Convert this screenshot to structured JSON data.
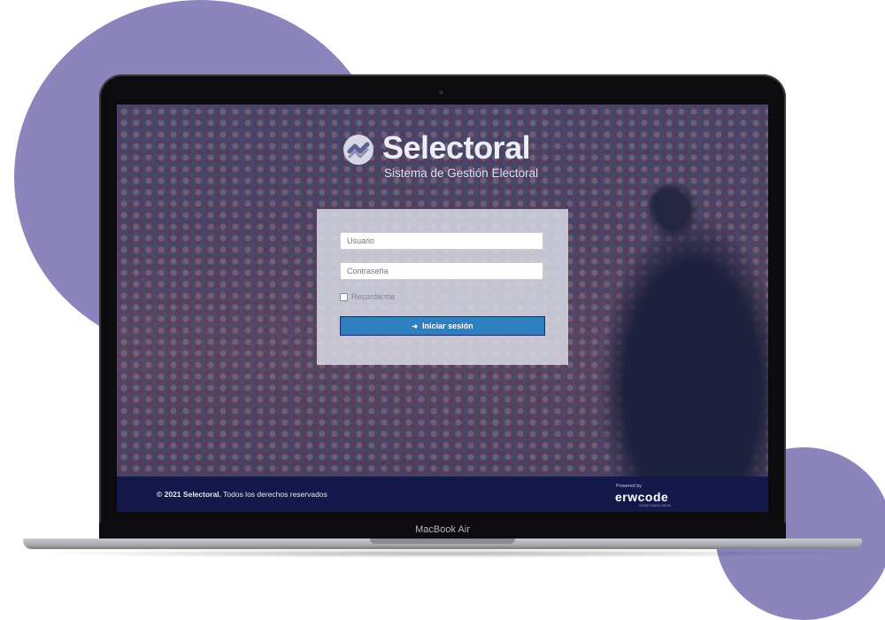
{
  "app": {
    "brand_name": "Selectoral",
    "brand_subtitle": "Sistema de Gestión Electoral"
  },
  "login": {
    "username_placeholder": "Usuario",
    "password_placeholder": "Contraseña",
    "remember_label": "Recordarme",
    "submit_label": "Iniciar sesión",
    "submit_icon": "sign-in-icon"
  },
  "footer": {
    "copyright_year": "© 2021",
    "copyright_brand": "Selectoral.",
    "copyright_text": "Todos los derechos reservados",
    "powered_by": "Powered by",
    "vendor": "erwcode",
    "vendor_sub": "CONECTANDO IDEAS"
  },
  "device": {
    "model": "MacBook Air"
  },
  "colors": {
    "blob": "#8b84bd",
    "button": "#2e7fc0",
    "footer_bg": "#14184a"
  }
}
